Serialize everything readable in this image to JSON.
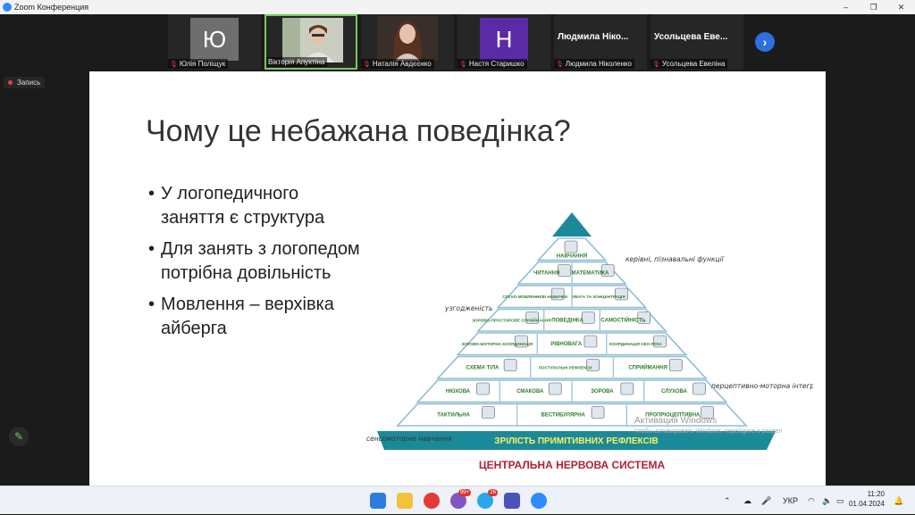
{
  "window": {
    "title": "Zoom Конференция",
    "controls": [
      "–",
      "❐",
      "✕"
    ]
  },
  "participants": [
    {
      "initial": "Ю",
      "name": "Юлія Поліщук",
      "color": "#6e6e6e",
      "muted": true
    },
    {
      "initial": "",
      "name": "Вікторія Апухтіна",
      "muted": false,
      "active": true
    },
    {
      "initial": "",
      "name": "Наталія Авдєєнко",
      "muted": true
    },
    {
      "initial": "Н",
      "name": "Настя Старишко",
      "color": "#5b2aa6",
      "muted": true
    },
    {
      "bigname": "Людмила Ніко...",
      "name": "Людмила Ніколенко",
      "muted": true
    },
    {
      "bigname": "Усольцева Еве...",
      "name": "Усольцева Евеліна",
      "muted": true
    }
  ],
  "strip": {
    "next_icon": "chevron-right-icon",
    "next_glyph": "›"
  },
  "recording": {
    "label": "Запись"
  },
  "annotate": {
    "icon": "pencil-icon",
    "glyph": "✎"
  },
  "slide": {
    "title": "Чому це небажана поведінка?",
    "bullets": [
      "У логопедичного заняття є структура",
      "Для занять з логопедом потрібна довільність",
      "Мовлення – верхівка айберга"
    ],
    "pyramid": {
      "rows": [
        [
          "НАВЧАННЯ"
        ],
        [
          "ЧИТАННЯ",
          "МАТЕМАТИКА"
        ],
        [
          "СЛУХО-МОВЛЕННЄВІ НАВИЧКИ",
          "УВАГА ТА КОНЦЕНТРАЦІЯ"
        ],
        [
          "ЗОРОВО-ПРОСТОРОВЕ СПРИЙМАННЯ",
          "ПОВЕДІНКА",
          "САМОСТІЙНІСТЬ"
        ],
        [
          "ЗОРОВО-МОТОРНА КООРДИНАЦІЯ",
          "РІВНОВАГА",
          "КООРДИНАЦІЯ ОКО-РУКА"
        ],
        [
          "СХЕМА ТІЛА",
          "ПОСТУРАЛЬНІ РЕФЛЕКСИ",
          "СПРИЙМАННЯ"
        ],
        [
          "НЮХОВА",
          "СМАКОВА",
          "ЗОРОВА",
          "СЛУХОВА"
        ],
        [
          "ТАКТИЛЬНА",
          "ВЕСТИБУЛЯРНА",
          "ПРОПРІОЦЕПТИВНА"
        ]
      ],
      "base": "ЗРІЛІСТЬ ПРИМІТИВНИХ РЕФЛЕКСІВ",
      "caption": "ЦЕНТРАЛЬНА НЕРВОВА СИСТЕМА",
      "notes": {
        "top": "керівні, пізнавальні функції",
        "left_mid": "узгодженість",
        "right_mid": "перцептивно-моторна інтеграція",
        "left_low": "сенсомоторне навчання"
      },
      "colors": {
        "base": "#1a8a9a",
        "label": "#2f7d2f",
        "caption": "#b0203a",
        "tip": "#1a8a9a"
      }
    }
  },
  "watermark": {
    "line1": "Активация Windows",
    "line2": "Чтобы активировать Windows, перейдите в раздел"
  },
  "taskbar": {
    "badges": [
      "99+",
      "26"
    ],
    "language": "УКР",
    "time": "11:20",
    "date": "01.04.2024"
  }
}
